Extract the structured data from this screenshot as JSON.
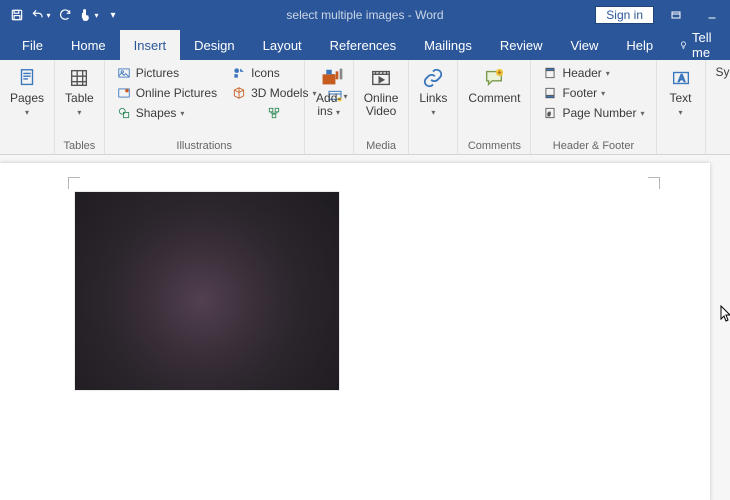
{
  "titlebar": {
    "doc_name": "select multiple images",
    "app_suffix": "  -  Word",
    "signin": "Sign in"
  },
  "tabs": {
    "file": "File",
    "home": "Home",
    "insert": "Insert",
    "design": "Design",
    "layout": "Layout",
    "references": "References",
    "mailings": "Mailings",
    "review": "Review",
    "view": "View",
    "help": "Help",
    "tellme": "Tell me"
  },
  "ribbon": {
    "pages": {
      "btn": "Pages",
      "group": ""
    },
    "tables": {
      "btn": "Table",
      "group": "Tables"
    },
    "illustrations": {
      "pictures": "Pictures",
      "online_pictures": "Online Pictures",
      "shapes": "Shapes",
      "icons": "Icons",
      "models": "3D Models",
      "group": "Illustrations"
    },
    "addins": {
      "btn": "Add-\nins",
      "group": ""
    },
    "media": {
      "btn": "Online\nVideo",
      "group": "Media"
    },
    "links": {
      "btn": "Links",
      "group": ""
    },
    "comments": {
      "btn": "Comment",
      "group": "Comments"
    },
    "headerfooter": {
      "header": "Header",
      "footer": "Footer",
      "pagenum": "Page Number",
      "group": "Header & Footer"
    },
    "text": {
      "btn": "Text",
      "group": ""
    },
    "symbols": {
      "btn": "Sy"
    }
  }
}
